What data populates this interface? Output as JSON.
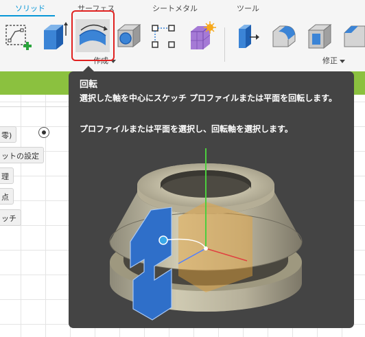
{
  "toolbar": {
    "tabs": [
      {
        "label": "ソリッド",
        "active": true
      },
      {
        "label": "サーフェス",
        "active": false
      },
      {
        "label": "シートメタル",
        "active": false
      },
      {
        "label": "ツール",
        "active": false
      }
    ],
    "groups": {
      "create": "作成",
      "modify": "修正"
    },
    "tools": [
      {
        "icon": "create-sketch-icon"
      },
      {
        "icon": "extrude-icon"
      },
      {
        "icon": "revolve-icon",
        "highlighted": true
      },
      {
        "icon": "hole-icon"
      },
      {
        "icon": "pattern-icon"
      },
      {
        "icon": "create-form-icon"
      },
      {
        "icon": "press-pull-icon"
      },
      {
        "icon": "fillet-icon"
      },
      {
        "icon": "shell-icon"
      },
      {
        "icon": "chamfer-icon"
      }
    ],
    "accent_color": "#0696d7",
    "highlight_color": "#e0201f"
  },
  "left_panel": {
    "items": [
      {
        "label": "零)"
      },
      {
        "label": "ットの設定"
      },
      {
        "label": "理"
      },
      {
        "label": "点"
      },
      {
        "label": "ッチ"
      }
    ]
  },
  "tooltip": {
    "title": "回転",
    "description": "選択した軸を中心にスケッチ プロファイルまたは平面を回転します。",
    "hint": "プロファイルまたは平面を選択し、回転軸を選択します。",
    "background": "#444444"
  },
  "colors": {
    "status_band": "#8bc13f",
    "profile_blue": "#2f6fc9"
  }
}
